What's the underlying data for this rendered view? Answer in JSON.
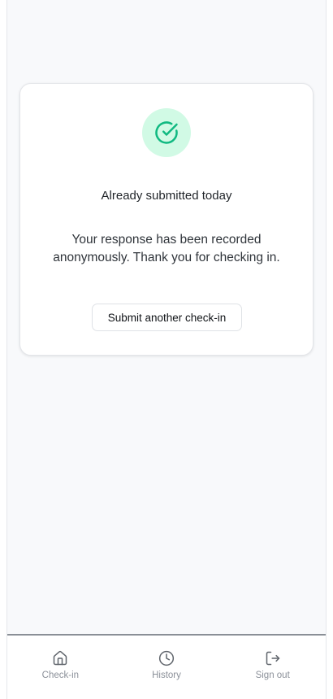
{
  "status_card": {
    "icon": "check-circle-icon",
    "accent_color": "#10b981",
    "badge_color": "#d1fae5",
    "title": "Already submitted today",
    "message": "Your response has been recorded anonymously. Thank you for checking in.",
    "button_label": "Submit another check-in"
  },
  "bottom_nav": {
    "items": [
      {
        "label": "Check-in",
        "icon": "home-icon"
      },
      {
        "label": "History",
        "icon": "clock-icon"
      },
      {
        "label": "Sign out",
        "icon": "sign-out-icon"
      }
    ]
  }
}
